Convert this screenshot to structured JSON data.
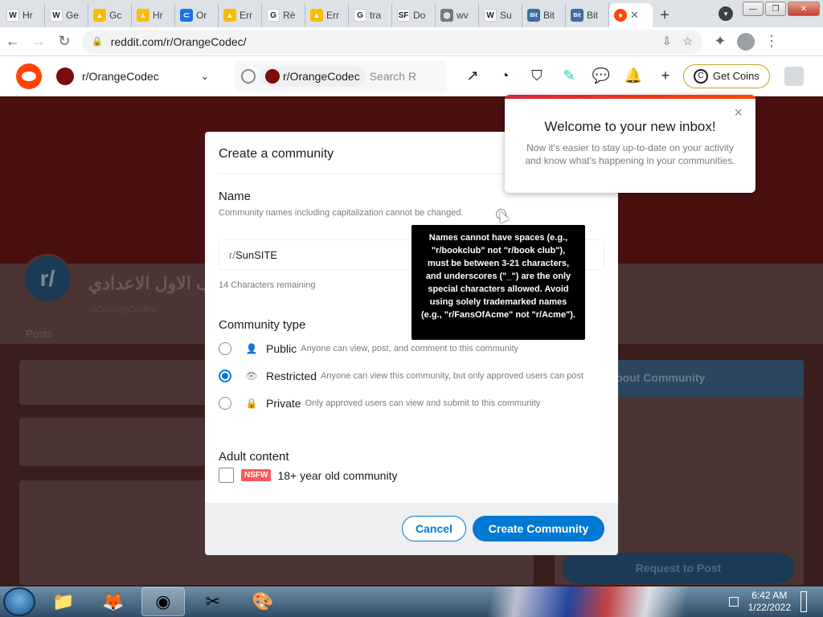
{
  "browser": {
    "tabs": [
      {
        "favicon": "wikipedia-icon",
        "label": "Hr",
        "color": "#ffffff",
        "glyph": "W"
      },
      {
        "favicon": "wikipedia-icon",
        "label": "Ge",
        "color": "#ffffff",
        "glyph": "W"
      },
      {
        "favicon": "google-drive-icon",
        "label": "Gc",
        "color": "#fbbc04",
        "glyph": "▲"
      },
      {
        "favicon": "google-drive-icon",
        "label": "Hr",
        "color": "#fbbc04",
        "glyph": "▲"
      },
      {
        "favicon": "link-icon",
        "label": "Or",
        "color": "#1a73e8",
        "glyph": "⊂"
      },
      {
        "favicon": "google-drive-icon",
        "label": "Err",
        "color": "#fbbc04",
        "glyph": "▲"
      },
      {
        "favicon": "google-icon",
        "label": "Rè",
        "color": "#ffffff",
        "glyph": "G"
      },
      {
        "favicon": "google-drive-icon",
        "label": "Err",
        "color": "#fbbc04",
        "glyph": "▲"
      },
      {
        "favicon": "google-icon",
        "label": "tra",
        "color": "#ffffff",
        "glyph": "G"
      },
      {
        "favicon": "sourceforge-icon",
        "label": "Do",
        "color": "#ffffff",
        "glyph": "SF"
      },
      {
        "favicon": "globe-icon",
        "label": "wv",
        "color": "#777777",
        "glyph": "◍"
      },
      {
        "favicon": "wikipedia-icon",
        "label": "Su",
        "color": "#ffffff",
        "glyph": "W"
      },
      {
        "favicon": "bitcoin-icon",
        "label": "Bit",
        "color": "#3a6ea5",
        "glyph": "Bit"
      },
      {
        "favicon": "bitcoin-icon",
        "label": "Bit",
        "color": "#3a6ea5",
        "glyph": "Bit"
      }
    ],
    "active_tab": {
      "favicon": "reddit-icon",
      "close": "✕"
    },
    "new_tab": "+",
    "url": "reddit.com/r/OrangeCodec/",
    "window_controls": {
      "minimize": "—",
      "maximize": "❐",
      "close": "✕"
    }
  },
  "reddit_header": {
    "community": "r/OrangeCodec",
    "search_chip": "r/OrangeCodec",
    "search_placeholder": "Search R",
    "get_coins": "Get Coins"
  },
  "background_page": {
    "community_title": "الصف الاول الاعدادي",
    "community_handle": "r/OrangeCodec",
    "tabs": "Posts",
    "sidebar_header": "About Community",
    "request_button": "Request to Post"
  },
  "modal": {
    "title": "Create a community",
    "name_heading": "Name",
    "name_note": "Community names including capitalization cannot be changed.",
    "input_prefix": "r/",
    "input_value": "SunSITE",
    "remaining": "14 Characters remaining",
    "type_heading": "Community type",
    "options": [
      {
        "label": "Public",
        "desc": "Anyone can view, post, and comment to this community",
        "icon": "person-icon",
        "selected": false
      },
      {
        "label": "Restricted",
        "desc": "Anyone can view this community, but only approved users can post",
        "icon": "eye-icon",
        "selected": true
      },
      {
        "label": "Private",
        "desc": "Only approved users can view and submit to this community",
        "icon": "lock-icon",
        "selected": false
      }
    ],
    "adult_heading": "Adult content",
    "nsfw_badge": "NSFW",
    "adult_label": "18+ year old community",
    "cancel": "Cancel",
    "create": "Create Community"
  },
  "tooltip": {
    "text": "Names cannot have spaces (e.g., \"r/bookclub\" not \"r/book club\"), must be between 3-21 characters, and underscores (\"_\") are the only special characters allowed. Avoid using solely trademarked names (e.g., \"r/FansOfAcme\" not \"r/Acme\")."
  },
  "inbox_popup": {
    "title": "Welcome to your new inbox!",
    "body": "Now it's easier to stay up-to-date on your activity and know what's happening in your communities.",
    "close": "×"
  },
  "taskbar": {
    "time": "6:42 AM",
    "date": "1/22/2022"
  }
}
